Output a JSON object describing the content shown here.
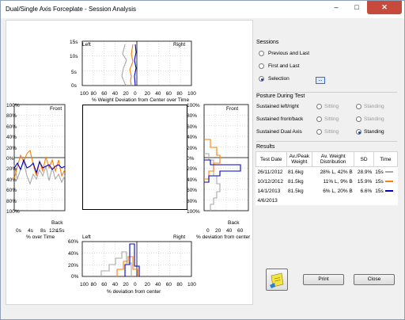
{
  "window": {
    "title": "Dual/Single Axis Forceplate - Session Analysis",
    "min_icon": "minimize-icon",
    "max_icon": "maximize-icon",
    "close_icon": "close-icon"
  },
  "top_chart": {
    "label_left": "Left",
    "label_right": "Right",
    "y_ticks": [
      "15s",
      "10s",
      "5s",
      "0s"
    ],
    "x_ticks": [
      "100",
      "80",
      "60",
      "40",
      "20",
      "0",
      "20",
      "40",
      "60",
      "80",
      "100"
    ],
    "caption": "% Weight Deviation from Center over Time"
  },
  "left_chart": {
    "y_ticks": [
      "100%",
      "80%",
      "60%",
      "40%",
      "20%",
      "0%",
      "20%",
      "40%",
      "60%",
      "80%",
      "100%"
    ],
    "label_front": "Front",
    "label_back": "Back",
    "x_ticks": [
      "0s",
      "4s",
      "8s",
      "12s",
      "15s"
    ],
    "caption": "% over Time"
  },
  "right_chart": {
    "y_ticks": [
      "100%",
      "80%",
      "60%",
      "40%",
      "20%",
      "0%",
      "20%",
      "40%",
      "60%",
      "80%",
      "100%"
    ],
    "label_front": "Front",
    "label_back": "Back",
    "x_ticks": [
      "0",
      "20",
      "40",
      "60"
    ],
    "caption": "% deviation from center"
  },
  "bottom_chart": {
    "y_ticks": [
      "60%",
      "40%",
      "20%",
      "0%"
    ],
    "label_left": "Left",
    "label_right": "Right",
    "x_ticks": [
      "100",
      "80",
      "60",
      "40",
      "20",
      "0",
      "20",
      "40",
      "60",
      "80",
      "100"
    ],
    "caption": "% deviation from center"
  },
  "sessions": {
    "heading": "Sessions",
    "options": [
      "Previous and Last",
      "First and Last",
      "Selection"
    ],
    "selected": "Selection",
    "dots_label": "..."
  },
  "posture": {
    "heading": "Posture During Test",
    "rows": [
      {
        "label": "Sustained left/right",
        "sitting": "Sitting",
        "standing": "Standing",
        "selected": "none"
      },
      {
        "label": "Sustained front/back",
        "sitting": "Sitting",
        "standing": "Standing",
        "selected": "none"
      },
      {
        "label": "Sustained Dual Axis",
        "sitting": "Sitting",
        "standing": "Standing",
        "selected": "Standing"
      }
    ]
  },
  "results": {
    "heading": "Results",
    "columns": [
      "Test Date",
      "Av./Peak Weight",
      "Av. Weight Distribution",
      "SD",
      "Time"
    ],
    "rows": [
      {
        "date": "26/11/2012",
        "weight": "81.6kg",
        "distribution": "28% L, 42% B",
        "sd": "28.9%",
        "time": "15s",
        "color": "#a8a8a8"
      },
      {
        "date": "10/12/2012",
        "weight": "81.5kg",
        "distribution": "11% L, 9% B",
        "sd": "15.9%",
        "time": "15s",
        "color": "#ff7f00"
      },
      {
        "date": "14/1/2013",
        "weight": "81.5kg",
        "distribution": "6% L, 20% B",
        "sd": "6.6%",
        "time": "15s",
        "color": "#0000c8"
      },
      {
        "date": "4/6/2013",
        "weight": "",
        "distribution": "",
        "sd": "",
        "time": "",
        "color": ""
      }
    ]
  },
  "buttons": {
    "note_icon": "sticky-note-icon",
    "print": "Print",
    "close": "Close"
  },
  "colors": {
    "series1": "#a8a8a8",
    "series2": "#ff7f00",
    "series3": "#0000c8"
  }
}
